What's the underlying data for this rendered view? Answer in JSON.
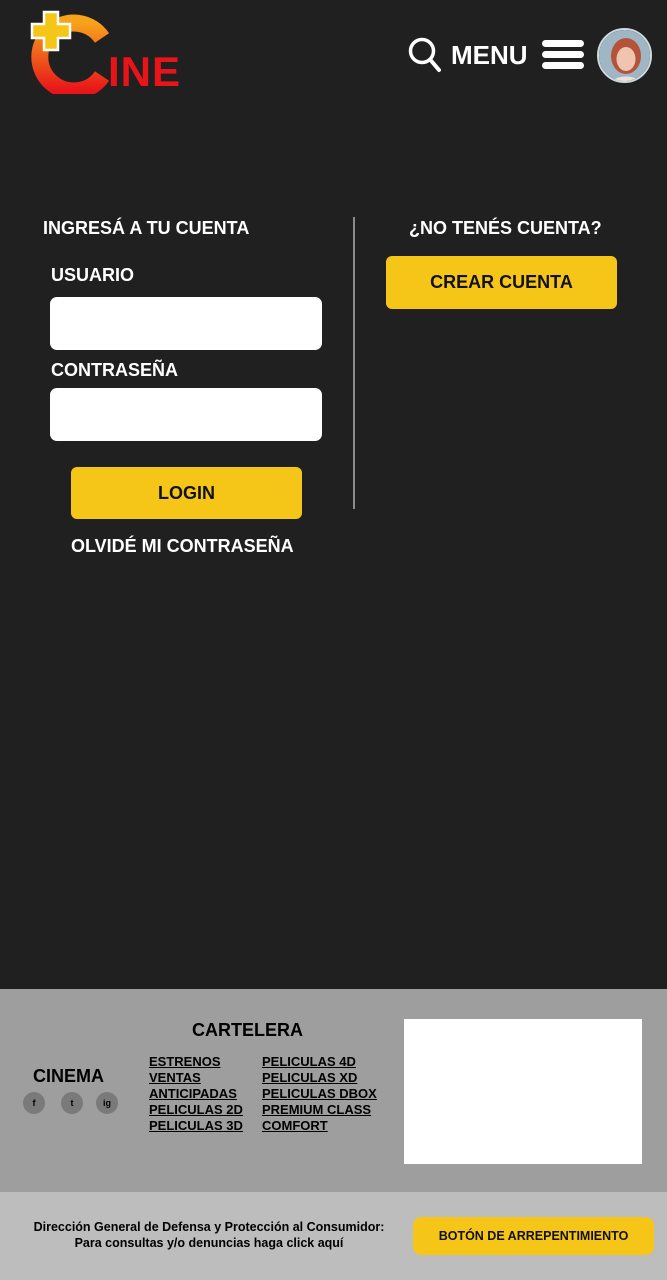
{
  "header": {
    "logo_text": "INE",
    "menu_label": "MENU",
    "icons": {
      "search": "search-icon",
      "menu": "hamburger-icon",
      "avatar": "user-avatar"
    }
  },
  "login": {
    "title": "INGRESÁ A TU CUENTA",
    "username_label": "USUARIO",
    "username_value": "",
    "password_label": "CONTRASEÑA",
    "password_value": "",
    "login_button": "LOGIN",
    "forgot_link": "OLVIDÉ MI CONTRASEÑA"
  },
  "register": {
    "title": "¿NO TENÉS CUENTA?",
    "create_button": "CREAR CUENTA"
  },
  "footer": {
    "brand": "CINEMA",
    "social": [
      "f",
      "t",
      "ig"
    ],
    "cartelera_title": "CARTELERA",
    "links_col1": [
      "ESTRENOS",
      "VENTAS",
      "ANTICIPADAS",
      "PELICULAS 2D",
      "PELICULAS 3D"
    ],
    "links_col2": [
      "PELICULAS 4D",
      "PELICULAS XD",
      "PELICULAS DBOX",
      "PREMIUM CLASS",
      "COMFORT"
    ]
  },
  "bottom": {
    "consumer_line1": "Dirección General de Defensa y Protección al Consumidor:",
    "consumer_line2": "Para consultas y/o denuncias haga click aquí",
    "repent_button": "BOTÓN DE ARREPENTIMIENTO"
  },
  "colors": {
    "background": "#202020",
    "accent": "#f5c518",
    "logo_red": "#e8141a",
    "footer_bg": "#9e9e9e",
    "bottom_bg": "#bdbdbd"
  }
}
